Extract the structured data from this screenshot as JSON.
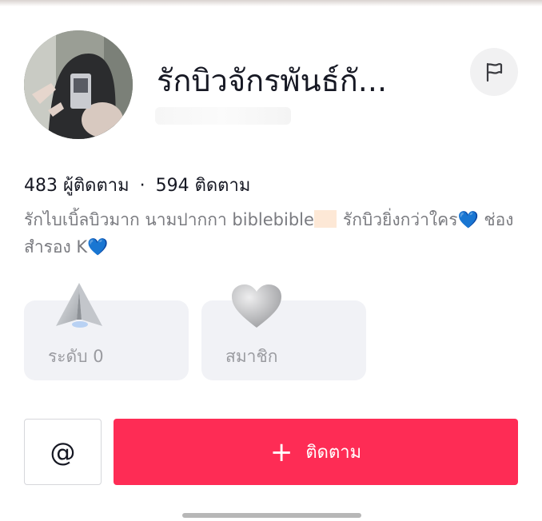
{
  "profile": {
    "username": "รักบิวจักรพันธ์กั...",
    "followers_count": "483",
    "followers_label": "ผู้ติดตาม",
    "separator": "·",
    "following_count": "594",
    "following_label": "ติดตาม",
    "bio_part1": "รักไบเบิ้ลบิวมาก นามปากกา biblebible",
    "bio_part2": "รักบิวยิ่งกว่าใคร",
    "bio_heart": "💙",
    "bio_part3": " ช่องสำรอง K",
    "bio_heart2": "💙"
  },
  "cards": {
    "level_label": "ระดับ 0",
    "member_label": "สมาชิก"
  },
  "actions": {
    "mention_label": "@",
    "follow_plus": "+",
    "follow_label": "ติดตาม"
  },
  "icons": {
    "report": "flag-icon",
    "level": "paper-plane-icon",
    "member": "heart-icon"
  },
  "colors": {
    "accent": "#fe2c55",
    "card_bg": "#f1f2f6",
    "muted_text": "#7a7b80",
    "heart": "#5ab4ec"
  }
}
